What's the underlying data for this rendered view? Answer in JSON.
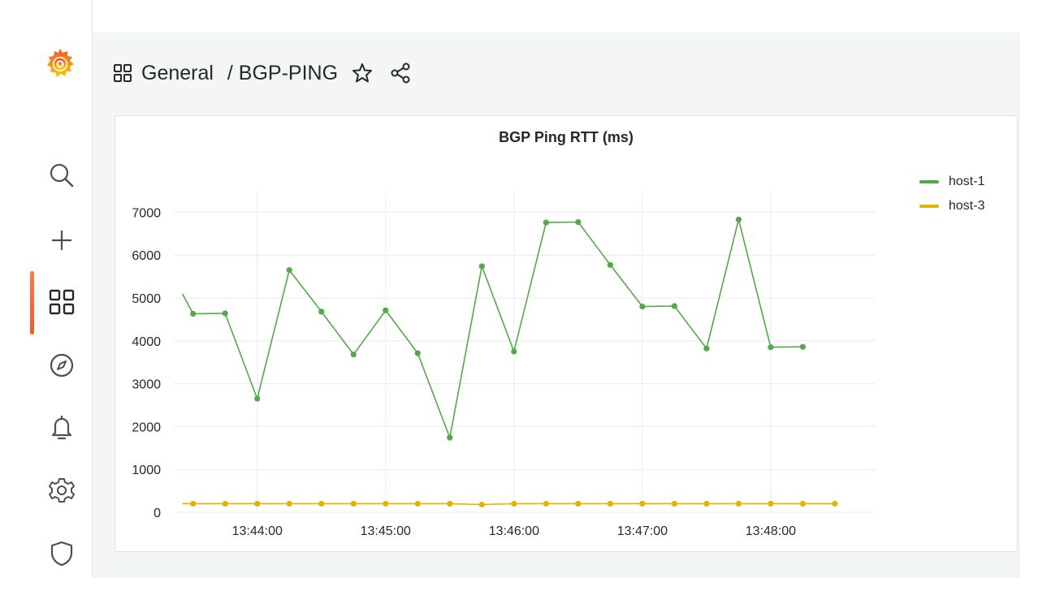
{
  "header": {
    "crumb_folder": "General",
    "crumb_separator": " / ",
    "crumb_dashboard": "BGP-PING"
  },
  "sidebar": {
    "icons": [
      "grafana-logo-icon",
      "search-icon",
      "plus-icon",
      "dashboards-icon",
      "explore-icon",
      "alerting-icon",
      "settings-icon",
      "shield-icon"
    ],
    "active": "dashboards-icon"
  },
  "panel": {
    "title": "BGP Ping RTT (ms)"
  },
  "colors": {
    "host1": "#56a64b",
    "host3": "#e0b400",
    "accent": "#f05a28"
  },
  "chart_data": {
    "type": "line",
    "title": "BGP Ping RTT (ms)",
    "xlabel": "",
    "ylabel": "",
    "ylim": [
      0,
      7500
    ],
    "y_ticks": [
      "0",
      "1000",
      "2000",
      "3000",
      "4000",
      "5000",
      "6000",
      "7000"
    ],
    "x_ticks": [
      "13:44:00",
      "13:45:00",
      "13:46:00",
      "13:47:00",
      "13:48:00"
    ],
    "x": [
      "13:43:25",
      "13:43:30",
      "13:43:45",
      "13:44:00",
      "13:44:15",
      "13:44:30",
      "13:44:45",
      "13:45:00",
      "13:45:15",
      "13:45:30",
      "13:45:45",
      "13:46:00",
      "13:46:15",
      "13:46:30",
      "13:46:45",
      "13:47:00",
      "13:47:15",
      "13:47:30",
      "13:47:45",
      "13:48:00",
      "13:48:15",
      "13:48:30"
    ],
    "legend_position": "top-right",
    "grid": true,
    "series": [
      {
        "name": "host-1",
        "color": "#56a64b",
        "values": [
          5100,
          4630,
          4640,
          2650,
          5650,
          4680,
          3680,
          4710,
          3710,
          1740,
          5740,
          3750,
          6760,
          6770,
          5770,
          4800,
          4810,
          3820,
          6830,
          3850,
          3860,
          null
        ]
      },
      {
        "name": "host-3",
        "color": "#e0b400",
        "values": [
          200,
          200,
          200,
          200,
          200,
          200,
          200,
          200,
          200,
          200,
          180,
          200,
          200,
          200,
          200,
          200,
          200,
          200,
          200,
          200,
          200,
          200
        ]
      }
    ]
  }
}
